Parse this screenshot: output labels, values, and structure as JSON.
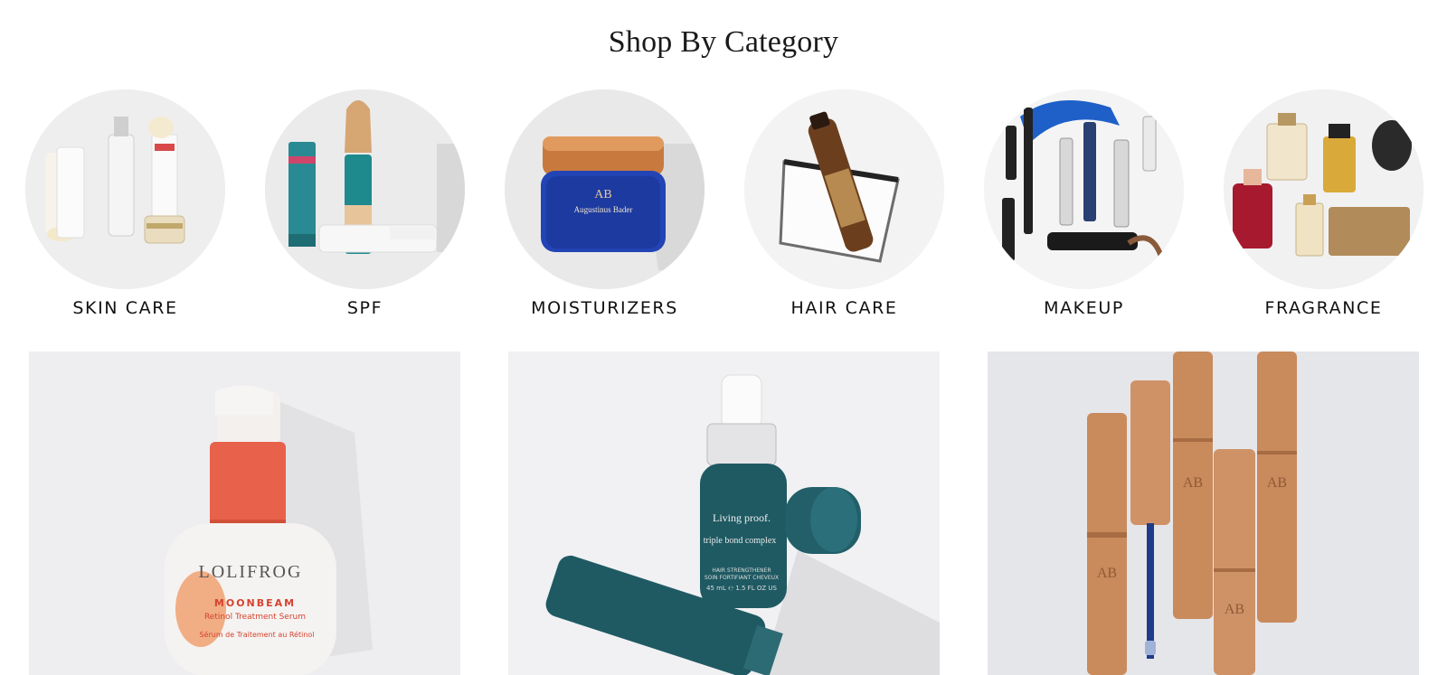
{
  "section": {
    "title": "Shop By Category"
  },
  "categories": [
    {
      "label": "SKIN CARE",
      "image_icon": "skincare-products-image"
    },
    {
      "label": "SPF",
      "image_icon": "spf-products-image"
    },
    {
      "label": "MOISTURIZERS",
      "image_icon": "moisturizer-jar-image"
    },
    {
      "label": "HAIR CARE",
      "image_icon": "haircare-products-image"
    },
    {
      "label": "MAKEUP",
      "image_icon": "makeup-products-image"
    },
    {
      "label": "FRAGRANCE",
      "image_icon": "fragrance-bottles-image"
    }
  ],
  "promos": [
    {
      "brand_text": "LOLIFROG",
      "product_name": "MOONBEAM",
      "product_sub": "Retinol Treatment Serum",
      "product_fr": "Sérum de Traitement au Rétinol",
      "accent": "#e8614a"
    },
    {
      "brand_text": "Living proof.",
      "product_name": "triple bond complex",
      "product_sub": "HAIR STRENGTHENER",
      "product_fr": "SOIN FORTIFIANT CHEVEUX",
      "size": "45 mL ℮ 1.5 FL OZ US",
      "accent": "#1f5a63"
    },
    {
      "brand_text": "AB",
      "accent": "#c98a5c"
    }
  ],
  "colors": {
    "background": "#ffffff",
    "circle_bg": "#ececec",
    "text": "#111111"
  }
}
